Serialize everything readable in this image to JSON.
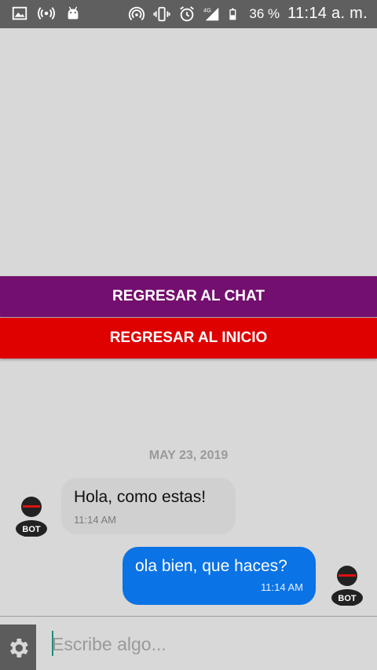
{
  "status_bar": {
    "battery_percent": "36 %",
    "time": "11:14 a. m.",
    "network_label": "4G",
    "icons": [
      "image-icon",
      "radio-signal-icon",
      "android-icon",
      "hotspot-icon",
      "vibrate-icon",
      "alarm-icon",
      "signal-icon",
      "battery-icon"
    ]
  },
  "buttons": {
    "back_to_chat": "REGRESAR AL CHAT",
    "back_to_home": "REGRESAR AL INICIO"
  },
  "colors": {
    "back_to_chat": "#730f6f",
    "back_to_home": "#df0000",
    "outgoing_bubble": "#0a73e5",
    "incoming_bubble": "#d0d0d0"
  },
  "chat": {
    "date": "MAY 23, 2019",
    "messages": [
      {
        "side": "incoming",
        "text": "Hola, como estas!",
        "time": "11:14 AM",
        "avatar": "BOT"
      },
      {
        "side": "outgoing",
        "text": "ola bien, que haces?",
        "time": "11:14 AM",
        "avatar": "BOT"
      }
    ]
  },
  "composer": {
    "placeholder": "Escribe algo...",
    "value": ""
  }
}
